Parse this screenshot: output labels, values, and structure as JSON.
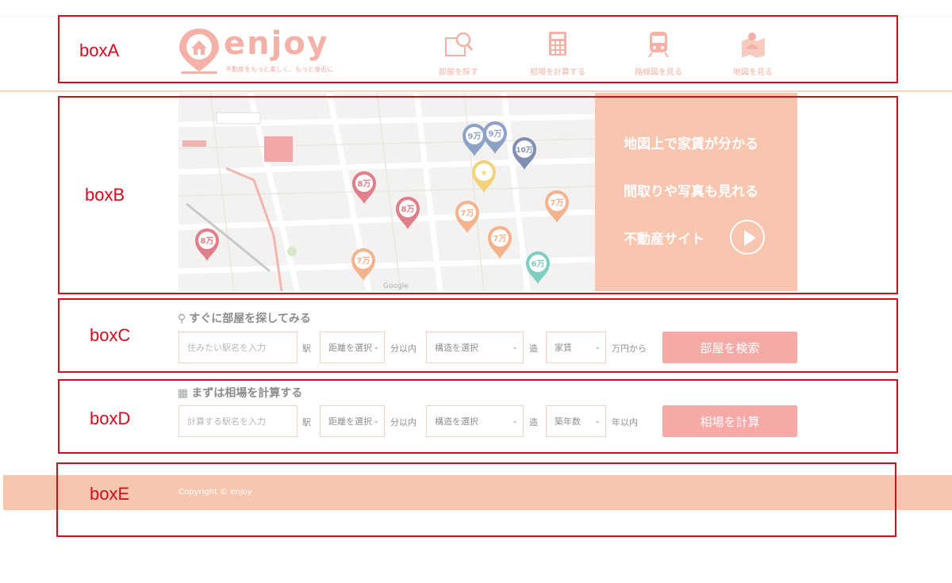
{
  "header": {
    "logo_text": "enjoy",
    "tagline": "不動産をもっと楽しく、もっと身近に",
    "nav": [
      {
        "label": "部屋を探す",
        "icon": "room-search-icon"
      },
      {
        "label": "相場を計算する",
        "icon": "calculator-icon"
      },
      {
        "label": "路線図を見る",
        "icon": "train-icon"
      },
      {
        "label": "地図を見る",
        "icon": "map-person-icon"
      }
    ]
  },
  "hero": {
    "lines": [
      "地図上で家賃が分かる",
      "間取りや写真も見れる",
      "不動産サイト"
    ],
    "map_pins": [
      {
        "label": "9万",
        "color": "#8ea2c8"
      },
      {
        "label": "9万",
        "color": "#8ea2c8"
      },
      {
        "label": "10万",
        "color": "#7f8fb4"
      },
      {
        "label": "★",
        "color": "#f3d27a"
      },
      {
        "label": "8万",
        "color": "#e07f89"
      },
      {
        "label": "8万",
        "color": "#e07f89"
      },
      {
        "label": "8万",
        "color": "#e07f89"
      },
      {
        "label": "7万",
        "color": "#f4b38c"
      },
      {
        "label": "7万",
        "color": "#f4b38c"
      },
      {
        "label": "7万",
        "color": "#f4b38c"
      },
      {
        "label": "7万",
        "color": "#f4b38c"
      },
      {
        "label": "6万",
        "color": "#7fcfc0"
      }
    ],
    "map_brand": "Google"
  },
  "search_form": {
    "title": "すぐに部屋を探してみる",
    "station_placeholder": "住みたい駅名を入力",
    "station_suffix": "駅",
    "distance_select": "距離を選択",
    "distance_suffix": "分以内",
    "structure_select": "構造を選択",
    "structure_suffix": "造",
    "rent_select": "家賃",
    "rent_suffix": "万円から",
    "submit": "部屋を検索"
  },
  "calc_form": {
    "title": "まずは相場を計算する",
    "station_placeholder": "計算する駅名を入力",
    "station_suffix": "駅",
    "distance_select": "距離を選択",
    "distance_suffix": "分以内",
    "structure_select": "構造を選択",
    "structure_suffix": "造",
    "age_select": "築年数",
    "age_suffix": "年以内",
    "submit": "相場を計算"
  },
  "footer": {
    "copyright": "Copyright © enjoy"
  },
  "annotations": [
    "boxA",
    "boxB",
    "boxC",
    "boxD",
    "boxE"
  ],
  "colors": {
    "annotation": "#d40a1d",
    "accent": "#f7a9a5",
    "panel": "#f8c5ae"
  }
}
